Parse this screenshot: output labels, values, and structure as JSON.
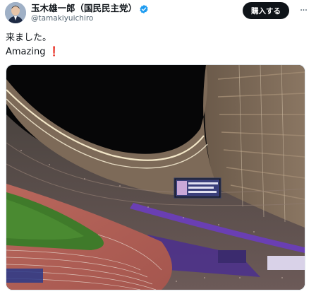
{
  "author": {
    "display_name": "玉木雄一郎（国民民主党）",
    "handle": "@tamakiyuichiro"
  },
  "icons": {
    "verified": "verified-badge-icon",
    "more": "more-dots-icon",
    "exclamation": "red-exclamation-icon"
  },
  "actions": {
    "buy_label": "購入する",
    "more_label": "···"
  },
  "tweet": {
    "line1": "来ました。",
    "line2": "Amazing",
    "line2_suffix": "❗"
  },
  "media": {
    "alt_kind": "stadium-photo"
  },
  "colors": {
    "text": "#0f1419",
    "secondary": "#536471",
    "verified": "#1d9bf0",
    "button_bg": "#0f1419",
    "exclaim": "#d4203a"
  }
}
